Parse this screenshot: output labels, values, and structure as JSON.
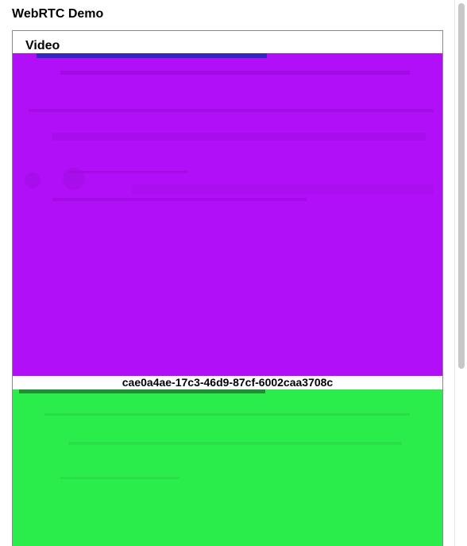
{
  "app": {
    "title": "WebRTC Demo"
  },
  "video_section": {
    "heading": "Video",
    "streams": [
      {
        "kind": "remote-video",
        "fill_color": "#b10ff8"
      },
      {
        "kind": "remote-video",
        "fill_color": "#2aec4a"
      }
    ],
    "stream_id": "cae0a4ae-17c3-46d9-87cf-6002caa3708c"
  },
  "colors": {
    "stream_1": "#b10ff8",
    "stream_2": "#2aec4a",
    "border": "#8a8a8a",
    "scrollbar_thumb": "#c7c7c7"
  }
}
